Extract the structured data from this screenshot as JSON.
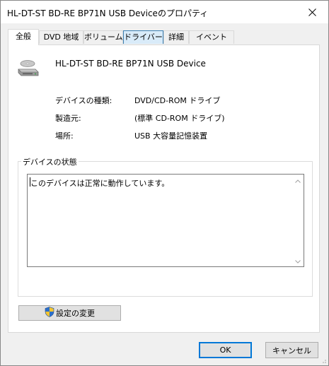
{
  "window": {
    "title": "HL-DT-ST BD-RE BP71N USB Deviceのプロパティ"
  },
  "tabs": [
    {
      "label": "全般"
    },
    {
      "label": "DVD 地域"
    },
    {
      "label": "ボリューム"
    },
    {
      "label": "ドライバー"
    },
    {
      "label": "詳細"
    },
    {
      "label": "イベント"
    }
  ],
  "general": {
    "device_name": "HL-DT-ST BD-RE BP71N USB Device",
    "properties": [
      {
        "label": "デバイスの種類:",
        "value": "DVD/CD-ROM ドライブ"
      },
      {
        "label": "製造元:",
        "value": "(標準 CD-ROM ドライブ)"
      },
      {
        "label": "場所:",
        "value": "USB 大容量記憶装置"
      }
    ],
    "status_group_label": "デバイスの状態",
    "status_text": "このデバイスは正常に動作しています。",
    "change_settings_label": "設定の変更"
  },
  "footer": {
    "ok_label": "OK",
    "cancel_label": "キャンセル"
  },
  "icons": {
    "close": "close-icon",
    "device": "optical-drive-icon",
    "shield": "uac-shield-icon",
    "scroll_up": "chevron-up-icon",
    "scroll_down": "chevron-down-icon"
  },
  "colors": {
    "ok_border": "#0078d7",
    "tab_hover": "#d9ebf9"
  }
}
